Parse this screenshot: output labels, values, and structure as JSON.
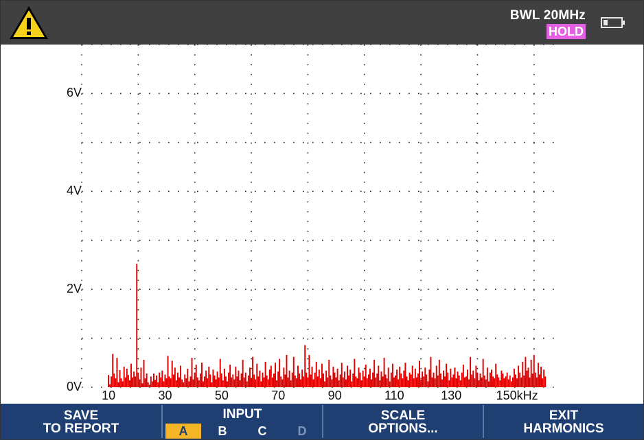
{
  "status": {
    "bandwidth_limit": "BWL 20MHz",
    "hold_badge": "HOLD",
    "warning_icon": "warning-triangle-icon",
    "battery_icon": "battery-low-icon",
    "hold_color": "#e45fe4"
  },
  "chart_data": {
    "type": "bar",
    "xlabel": "",
    "ylabel": "",
    "x_tick_labels": [
      "10",
      "30",
      "50",
      "70",
      "90",
      "110",
      "130",
      "150kHz"
    ],
    "y_tick_labels": [
      "0V",
      "2V",
      "4V",
      "6V"
    ],
    "ylim": [
      0,
      7
    ],
    "xlim": [
      0,
      170
    ],
    "grid": true,
    "bar_color": "#e00000",
    "series": [
      {
        "x_start_khz": 9.5,
        "x_step_khz": 0.5,
        "values": [
          0.25,
          0.06,
          0.22,
          0.68,
          0.28,
          0.18,
          0.6,
          0.1,
          0.35,
          0.18,
          0.12,
          0.42,
          0.2,
          0.38,
          0.25,
          0.14,
          0.48,
          0.2,
          0.32,
          0.22,
          2.52,
          0.3,
          0.16,
          0.4,
          0.08,
          0.56,
          0.18,
          0.28,
          0.1,
          0.05,
          0.22,
          0.12,
          0.28,
          0.15,
          0.24,
          0.1,
          0.3,
          0.2,
          0.34,
          0.12,
          0.26,
          0.18,
          0.64,
          0.22,
          0.18,
          0.54,
          0.26,
          0.4,
          0.14,
          0.3,
          0.2,
          0.44,
          0.16,
          0.1,
          0.26,
          0.18,
          0.38,
          0.12,
          0.22,
          0.6,
          0.16,
          0.3,
          0.46,
          0.2,
          0.14,
          0.28,
          0.5,
          0.12,
          0.22,
          0.34,
          0.18,
          0.42,
          0.26,
          0.1,
          0.36,
          0.24,
          0.16,
          0.32,
          0.2,
          0.58,
          0.28,
          0.14,
          0.38,
          0.22,
          0.12,
          0.3,
          0.46,
          0.2,
          0.26,
          0.16,
          0.42,
          0.22,
          0.34,
          0.14,
          0.28,
          0.56,
          0.2,
          0.3,
          0.12,
          0.24,
          0.4,
          0.18,
          0.62,
          0.26,
          0.16,
          0.48,
          0.22,
          0.34,
          0.12,
          0.3,
          0.2,
          0.52,
          0.24,
          0.16,
          0.36,
          0.44,
          0.2,
          0.28,
          0.5,
          0.14,
          0.32,
          0.58,
          0.22,
          0.16,
          0.4,
          0.26,
          0.66,
          0.2,
          0.34,
          0.14,
          0.3,
          0.62,
          0.24,
          0.18,
          0.44,
          0.28,
          0.16,
          0.36,
          0.22,
          0.86,
          0.3,
          0.2,
          0.66,
          0.26,
          0.42,
          0.16,
          0.3,
          0.52,
          0.22,
          0.36,
          0.18,
          0.48,
          0.28,
          0.12,
          0.34,
          0.2,
          0.56,
          0.24,
          0.16,
          0.42,
          0.3,
          0.2,
          0.38,
          0.14,
          0.26,
          0.5,
          0.2,
          0.32,
          0.16,
          0.44,
          0.24,
          0.36,
          0.12,
          0.28,
          0.58,
          0.22,
          0.18,
          0.4,
          0.3,
          0.14,
          0.34,
          0.22,
          0.46,
          0.18,
          0.26,
          0.38,
          0.16,
          0.3,
          0.56,
          0.2,
          0.28,
          0.44,
          0.14,
          0.32,
          0.22,
          0.6,
          0.26,
          0.18,
          0.4,
          0.12,
          0.3,
          0.48,
          0.2,
          0.24,
          0.36,
          0.16,
          0.42,
          0.28,
          0.18,
          0.34,
          0.5,
          0.22,
          0.14,
          0.3,
          0.26,
          0.44,
          0.18,
          0.38,
          0.2,
          0.28,
          0.54,
          0.16,
          0.32,
          0.22,
          0.4,
          0.26,
          0.12,
          0.36,
          0.62,
          0.2,
          0.3,
          0.18,
          0.44,
          0.24,
          0.56,
          0.28,
          0.16,
          0.34,
          0.22,
          0.48,
          0.3,
          0.14,
          0.38,
          0.2,
          0.26,
          0.4,
          0.18,
          0.32,
          0.24,
          0.14,
          0.3,
          0.46,
          0.2,
          0.22,
          0.36,
          0.16,
          0.62,
          0.26,
          0.34,
          0.18,
          0.44,
          0.3,
          0.14,
          0.28,
          0.2,
          0.58,
          0.24,
          0.16,
          0.4,
          0.12,
          0.3,
          0.36,
          0.22,
          0.18,
          0.48,
          0.26,
          0.2,
          0.14,
          0.34,
          0.28,
          0.18,
          0.22,
          0.3,
          0.16,
          0.24,
          0.12,
          0.2,
          0.38,
          0.26,
          0.18,
          0.44,
          0.3,
          0.2,
          0.52,
          0.24,
          0.62,
          0.34,
          0.4,
          0.2,
          0.56,
          0.28,
          0.66,
          0.3,
          0.2,
          0.5,
          0.26,
          0.42,
          0.18,
          0.36,
          0.22
        ]
      }
    ]
  },
  "menu": {
    "save": {
      "line1": "SAVE",
      "line2": "TO REPORT"
    },
    "input": {
      "title": "INPUT",
      "options": [
        "A",
        "B",
        "C",
        "D"
      ],
      "selected": "A",
      "selected_color": "#f4b526",
      "disabled_option": "D"
    },
    "scale": {
      "line1": "SCALE",
      "line2": "OPTIONS..."
    },
    "exit": {
      "line1": "EXIT",
      "line2": "HARMONICS"
    }
  }
}
